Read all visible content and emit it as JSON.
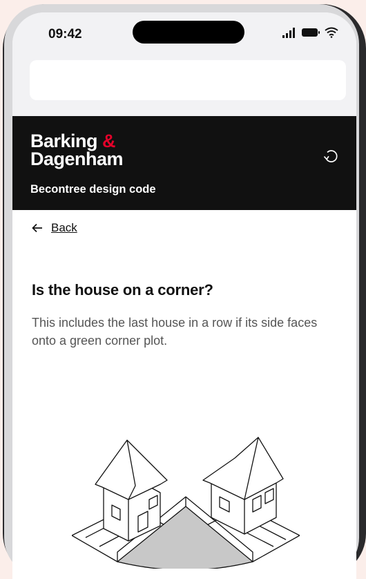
{
  "status_bar": {
    "time": "09:42"
  },
  "header": {
    "logo_line1": "Barking",
    "logo_amp": "&",
    "logo_line2": "Dagenham",
    "subtitle": "Becontree design code"
  },
  "nav": {
    "back_label": "Back"
  },
  "question": {
    "title": "Is the house on a corner?",
    "hint": "This includes the last house in a row if its side faces onto a green corner plot."
  },
  "icons": {
    "back": "arrow-left-icon",
    "reset": "undo-icon",
    "signal": "signal-icon",
    "battery": "battery-icon",
    "wifi": "wifi-icon"
  },
  "colors": {
    "header_bg": "#111111",
    "brand_accent": "#e4022a",
    "corner_plot_fill": "#c8c8c8"
  }
}
